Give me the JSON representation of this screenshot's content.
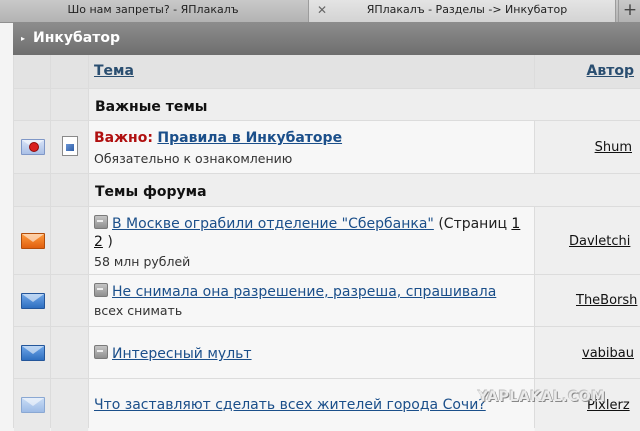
{
  "browser": {
    "tabs": [
      {
        "title": "Шо нам запреты? - ЯПлакалъ"
      },
      {
        "title": "ЯПлакалъ - Разделы -> Инкубатор",
        "close": "✕"
      }
    ],
    "new_tab": "+"
  },
  "forum": {
    "name": "Инкубатор",
    "arrow": "▸"
  },
  "columns": {
    "topic": "Тема",
    "author": "Автор"
  },
  "sections": {
    "important": "Важные темы",
    "forum": "Темы форума"
  },
  "pinned": {
    "prefix": "Важно:",
    "title": "Правила в Инкубаторе",
    "description": "Обязательно к ознакомлению",
    "author": "Shum"
  },
  "topics": [
    {
      "title": "В Москве ограбили отделение \"Сбербанка\"",
      "pages_label": "(Страниц",
      "page_1": "1",
      "page_2": "2",
      "pages_close": ")",
      "description": "58 млн рублей",
      "author": "Davletchi",
      "icon": "envelope-hot"
    },
    {
      "title": "Не снимала она разрешение, разреша, спрашивала",
      "description": "всех снимать",
      "author": "TheBorsh",
      "icon": "envelope-new"
    },
    {
      "title": "Интересный мульт",
      "description": "",
      "author": "vabibau",
      "icon": "envelope-new"
    },
    {
      "title": "Что заставляют сделать всех жителей города Сочи?",
      "description": "",
      "author": "Pixlerz",
      "icon": "envelope-read"
    }
  ],
  "watermark": "YAPLAKAL.COM",
  "colors": {
    "header_bg": "#7a7a7a",
    "link": "#1b4f8a",
    "important": "#b01010"
  }
}
